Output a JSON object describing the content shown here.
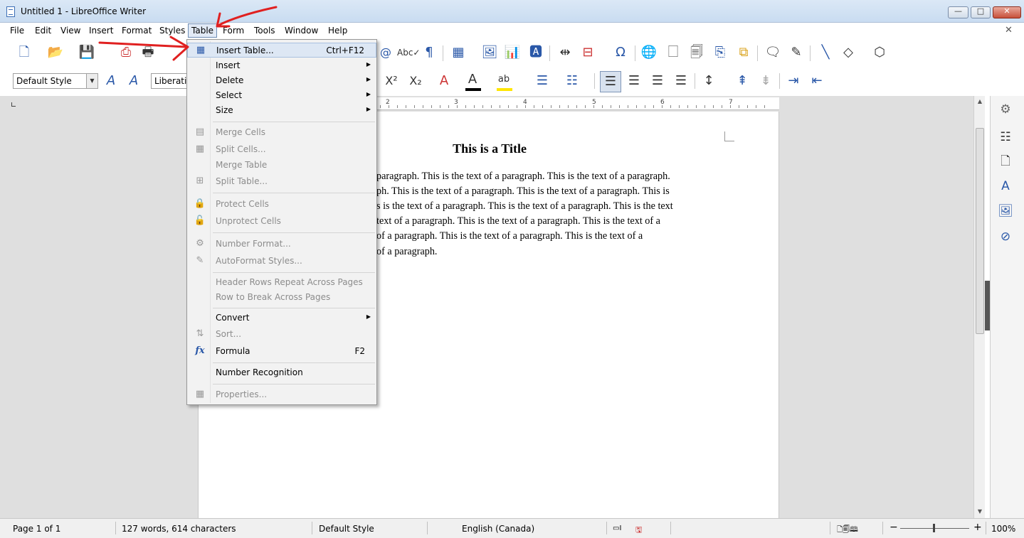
{
  "window": {
    "title": "Untitled 1 - LibreOffice Writer",
    "min_symbol": "—",
    "max_symbol": "□",
    "close_symbol": "✕"
  },
  "menubar": {
    "items": [
      "File",
      "Edit",
      "View",
      "Insert",
      "Format",
      "Styles",
      "Table",
      "Form",
      "Tools",
      "Window",
      "Help"
    ],
    "doc_close": "✕"
  },
  "toolbar2": {
    "paragraph_style": "Default Style",
    "font_name": "Liberation"
  },
  "ruler": {
    "numbers": [
      "2",
      "3",
      "4",
      "5",
      "6",
      "7"
    ]
  },
  "document": {
    "title": "This is a Title",
    "lines": [
      "paragraph.  This is the text of a paragraph.  This is the text of a paragraph.",
      "ph.  This is the text of a paragraph.  This is the text of a paragraph.  This is",
      "s is the text of a paragraph.  This is the text of a paragraph.  This is the text",
      "text of a paragraph.  This is the text of a paragraph.  This is the text of a",
      "of a paragraph.  This is the text of a paragraph.  This is the text of a",
      "of a paragraph."
    ]
  },
  "table_menu": {
    "items": [
      {
        "label": "Insert Table...",
        "shortcut": "Ctrl+F12",
        "highlighted": true,
        "icon": "table-icon"
      },
      {
        "label": "Insert",
        "submenu": true
      },
      {
        "label": "Delete",
        "submenu": true
      },
      {
        "label": "Select",
        "submenu": true
      },
      {
        "label": "Size",
        "submenu": true
      },
      {
        "label": "Merge Cells",
        "disabled": true,
        "icon": "merge-cells-icon"
      },
      {
        "label": "Split Cells...",
        "disabled": true,
        "icon": "split-cells-icon"
      },
      {
        "label": "Merge Table",
        "disabled": true
      },
      {
        "label": "Split Table...",
        "disabled": true,
        "icon": "split-table-icon"
      },
      {
        "label": "Protect Cells",
        "disabled": true,
        "icon": "lock-icon"
      },
      {
        "label": "Unprotect Cells",
        "disabled": true,
        "icon": "unlock-icon"
      },
      {
        "label": "Number Format...",
        "disabled": true,
        "icon": "number-format-icon"
      },
      {
        "label": "AutoFormat Styles...",
        "disabled": true,
        "icon": "autoformat-icon"
      },
      {
        "label": "Header Rows Repeat Across Pages",
        "disabled": true
      },
      {
        "label": "Row to Break Across Pages",
        "disabled": true
      },
      {
        "label": "Convert",
        "submenu": true
      },
      {
        "label": "Sort...",
        "disabled": true,
        "icon": "sort-icon"
      },
      {
        "label": "Formula",
        "shortcut": "F2",
        "icon": "formula-icon"
      },
      {
        "label": "Number Recognition"
      },
      {
        "label": "Properties...",
        "disabled": true,
        "icon": "table-properties-icon"
      }
    ],
    "submenu_arrow": "▶",
    "formula_glyph": "fx"
  },
  "statusbar": {
    "page": "Page 1 of 1",
    "words": "127 words, 614 characters",
    "style": "Default Style",
    "language": "English (Canada)",
    "zoom": "100%",
    "zoom_minus": "−",
    "zoom_plus": "+"
  },
  "colors": {
    "accent": "#2a58a8",
    "annotation": "#e02020",
    "font_color_bar": "#000000",
    "highlight_bar": "#ffe600"
  }
}
